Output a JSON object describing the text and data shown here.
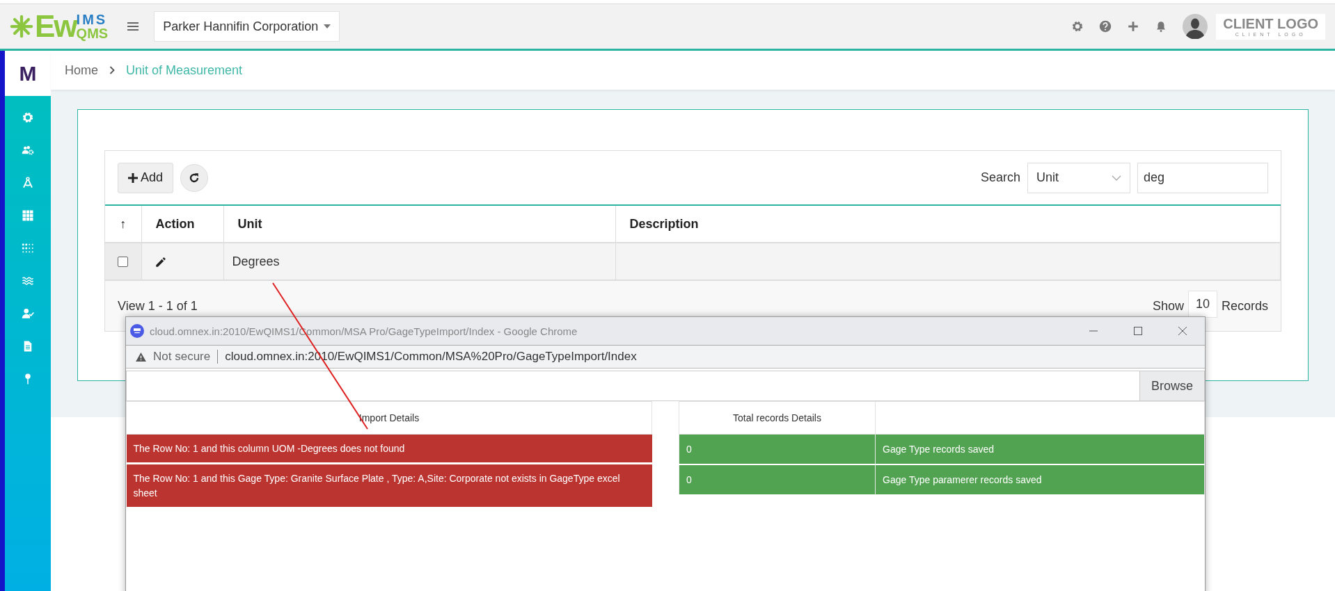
{
  "header": {
    "logo": {
      "main": "Ew",
      "sup": "IMS",
      "sub": "QMS"
    },
    "company_select": "Parker Hannifin Corporation",
    "client_logo": {
      "title": "CLIENT LOGO",
      "subtitle": "CLIENT LOGO"
    }
  },
  "sidebar": {
    "logo": "M"
  },
  "breadcrumb": [
    "Home",
    "Unit of Measurement"
  ],
  "toolbar": {
    "add": "Add",
    "search_label": "Search",
    "search_field": "Unit",
    "search_value": "deg"
  },
  "table": {
    "columns": [
      "↑",
      "Action",
      "Unit",
      "Description"
    ],
    "rows": [
      {
        "checked": false,
        "unit": "Degrees"
      }
    ]
  },
  "footer": {
    "view": "View 1 - 1 of 1",
    "show": "Show",
    "page_size": "10",
    "records": "Records"
  },
  "popup": {
    "title": "cloud.omnex.in:2010/EwQIMS1/Common/MSA Pro/GageTypeImport/Index - Google Chrome",
    "security": "Not secure",
    "url": "cloud.omnex.in:2010/EwQIMS1/Common/MSA%20Pro/GageTypeImport/Index",
    "browse": "Browse",
    "import_table": {
      "header": "Import Details",
      "rows": [
        "The Row No: 1 and this column UOM -Degrees does not found",
        "The Row No: 1 and this Gage Type: Granite Surface Plate , Type: A,Site: Corporate not exists in GageType excel sheet"
      ]
    },
    "totals_table": {
      "header": "Total records Details",
      "rows": [
        {
          "count": "0",
          "label": "Gage Type records saved"
        },
        {
          "count": "0",
          "label": "Gage Type paramerer records saved"
        }
      ]
    }
  }
}
